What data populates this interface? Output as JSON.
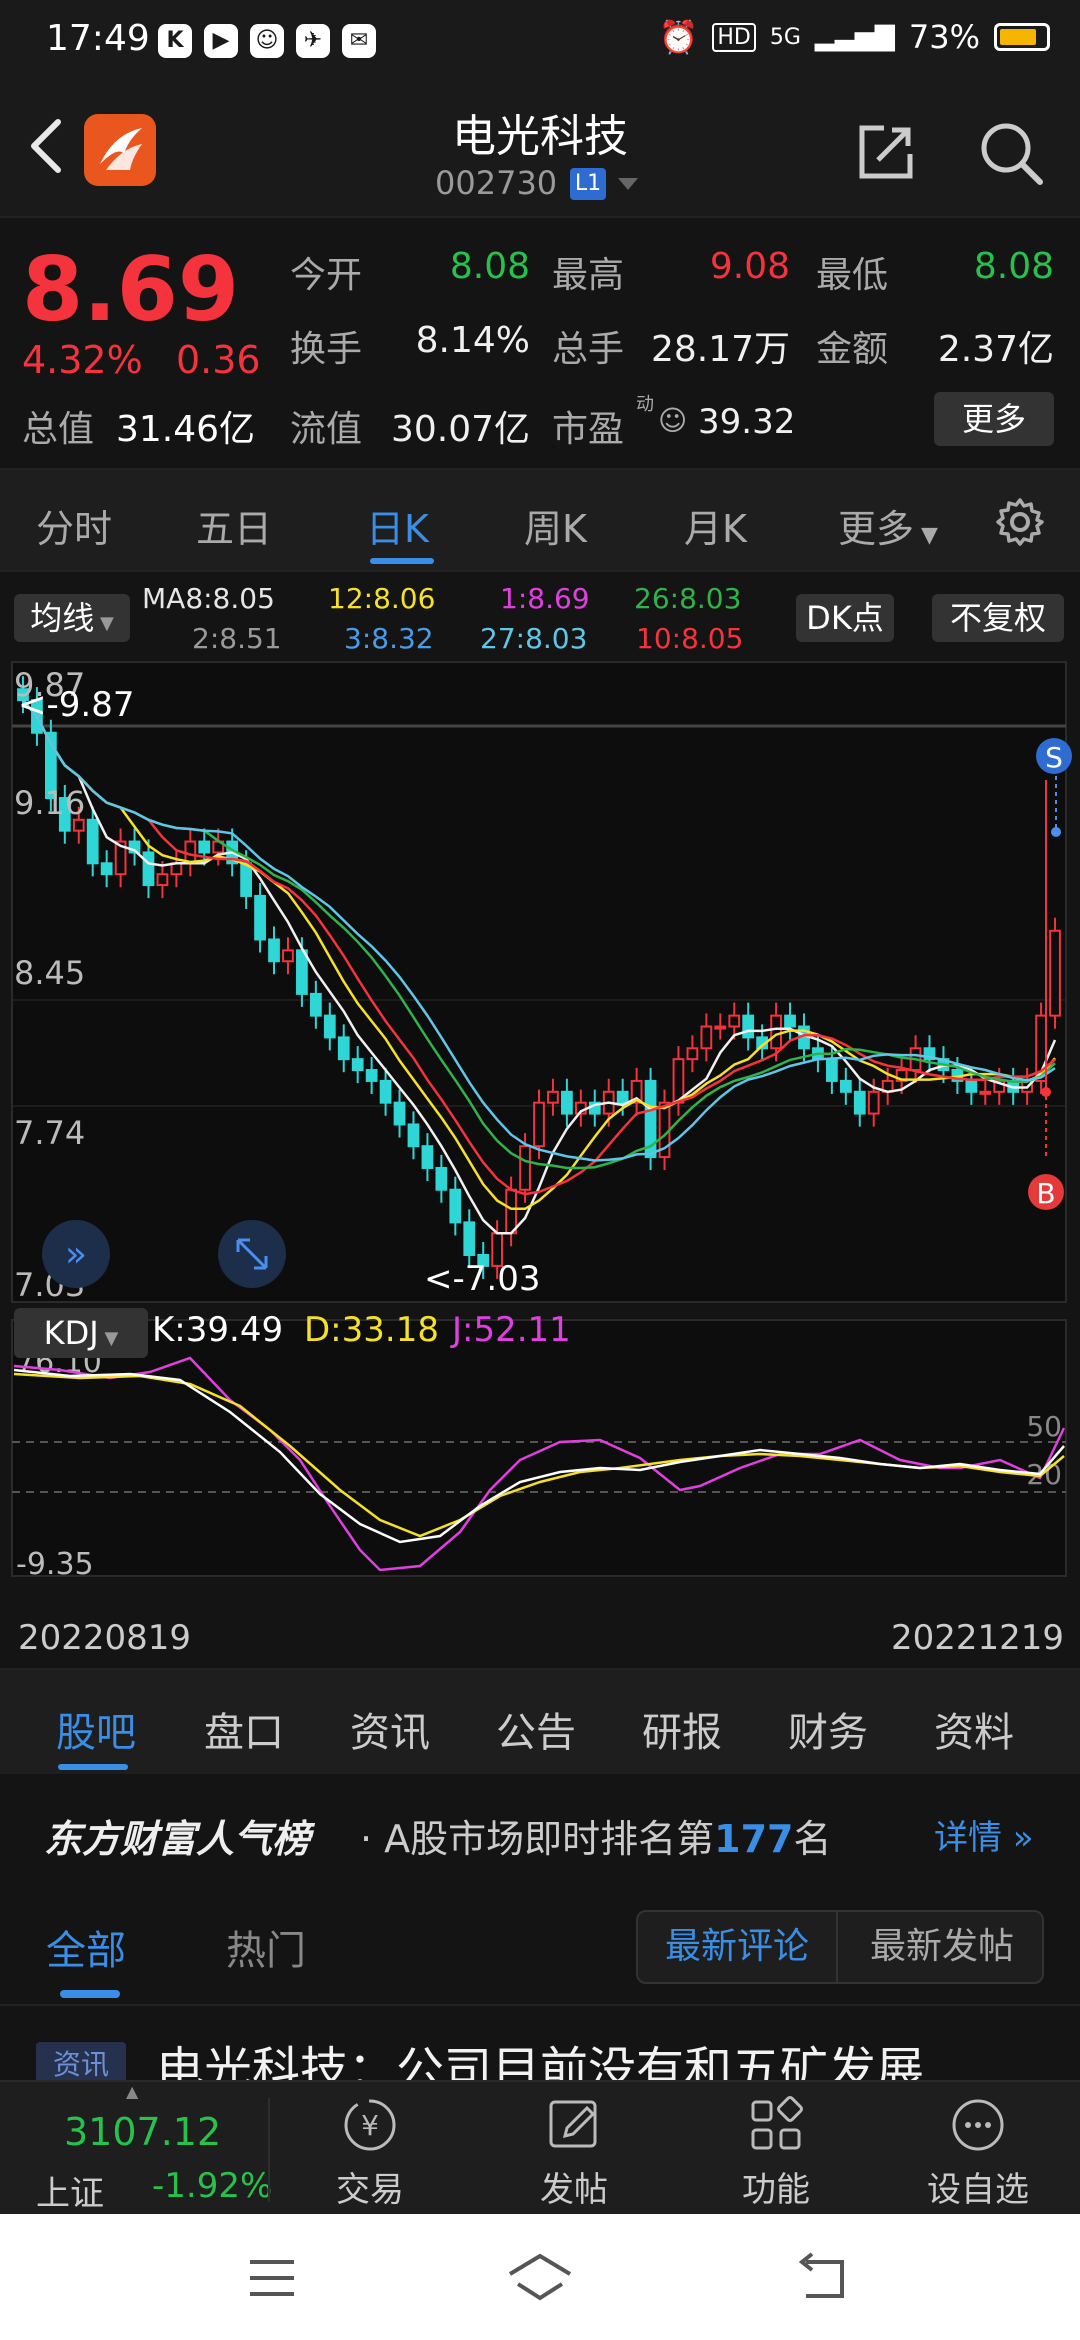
{
  "status_bar": {
    "time": "17:49",
    "app_icons": [
      "K",
      "▶",
      "☺",
      "✈",
      "✉"
    ],
    "network": "5G",
    "hd": "HD",
    "battery": "73%"
  },
  "header": {
    "stock_name": "电光科技",
    "stock_code": "002730",
    "level": "L1"
  },
  "quote": {
    "price": "8.69",
    "change_pct": "4.32%",
    "change_abs": "0.36",
    "total_mv_label": "总值",
    "total_mv": "31.46亿",
    "open_label": "今开",
    "open": "8.08",
    "high_label": "最高",
    "high": "9.08",
    "low_label": "最低",
    "low": "8.08",
    "turnover_label": "换手",
    "turnover": "8.14%",
    "volume_label": "总手",
    "volume": "28.17万",
    "amount_label": "金额",
    "amount": "2.37亿",
    "float_mv_label": "流值",
    "float_mv": "30.07亿",
    "pe_label": "市盈",
    "pe_sup": "动",
    "pe": "39.32",
    "more": "更多"
  },
  "period_tabs": [
    "分时",
    "五日",
    "日K",
    "周K",
    "月K",
    "更多"
  ],
  "ma": {
    "chip": "均线",
    "items": [
      {
        "label": "MA8:8.05",
        "color": "#e6e6e6"
      },
      {
        "label": "12:8.06",
        "color": "#f5e02a"
      },
      {
        "label": "1:8.69",
        "color": "#e040e0"
      },
      {
        "label": "26:8.03",
        "color": "#2fb34a"
      },
      {
        "label": "2:8.51",
        "color": "#9a9a9a"
      },
      {
        "label": "3:8.32",
        "color": "#4a9be8"
      },
      {
        "label": "27:8.03",
        "color": "#5fc6e8"
      },
      {
        "label": "10:8.05",
        "color": "#f4333c"
      }
    ],
    "dk_chip": "DK点",
    "adjust_chip": "不复权"
  },
  "chart_data": {
    "type": "candlestick",
    "y_ticks": [
      "9.87",
      "9.16",
      "8.45",
      "7.74",
      "7.03"
    ],
    "ylim": [
      7.03,
      9.87
    ],
    "max_annotation": "<-9.87",
    "min_annotation": "<-7.03",
    "x_start": "20220819",
    "x_end": "20221219",
    "sell_marker": "S",
    "buy_marker": "B",
    "closes": [
      9.75,
      9.6,
      9.3,
      9.15,
      9.2,
      9.0,
      8.95,
      9.1,
      9.05,
      8.9,
      8.95,
      9.0,
      9.1,
      9.05,
      9.1,
      9.0,
      8.85,
      8.65,
      8.55,
      8.6,
      8.4,
      8.3,
      8.2,
      8.1,
      8.05,
      8.0,
      7.9,
      7.8,
      7.7,
      7.6,
      7.5,
      7.35,
      7.2,
      7.15,
      7.3,
      7.5,
      7.7,
      7.9,
      7.95,
      7.85,
      7.9,
      7.85,
      7.95,
      7.9,
      8.0,
      7.65,
      7.9,
      8.1,
      8.15,
      8.25,
      8.25,
      8.3,
      8.2,
      8.15,
      8.3,
      8.25,
      8.15,
      8.1,
      8.0,
      7.95,
      7.85,
      7.95,
      8.0,
      8.05,
      8.15,
      8.1,
      8.05,
      8.0,
      7.95,
      7.95,
      8.0,
      7.95,
      8.0,
      8.3,
      8.69
    ],
    "kdj": {
      "label": "KDJ",
      "k": "K:39.49",
      "d": "D:33.18",
      "j": "J:52.11",
      "y_ticks": [
        "76.10",
        "50",
        "20",
        "-9.35"
      ],
      "k_color": "#ffffff",
      "d_color": "#f5e02a",
      "j_color": "#e040e0"
    }
  },
  "info_tabs": [
    "股吧",
    "盘口",
    "资讯",
    "公告",
    "研报",
    "财务",
    "资料"
  ],
  "rank": {
    "brand": "东方财富人气榜",
    "text_before": "· A股市场即时排名第",
    "rank": "177",
    "text_after": "名",
    "detail": "详情"
  },
  "feed_tabs": {
    "all": "全部",
    "hot": "热门",
    "latest_comment": "最新评论",
    "latest_post": "最新发帖"
  },
  "news_peek": {
    "badge": "资讯",
    "title": "电光科技：公司目前没有和五矿发展"
  },
  "action_bar": {
    "index_value": "3107.12",
    "index_name": "上证",
    "index_change": "-1.92%",
    "trade": "交易",
    "post": "发帖",
    "function": "功能",
    "watchlist": "设自选"
  }
}
